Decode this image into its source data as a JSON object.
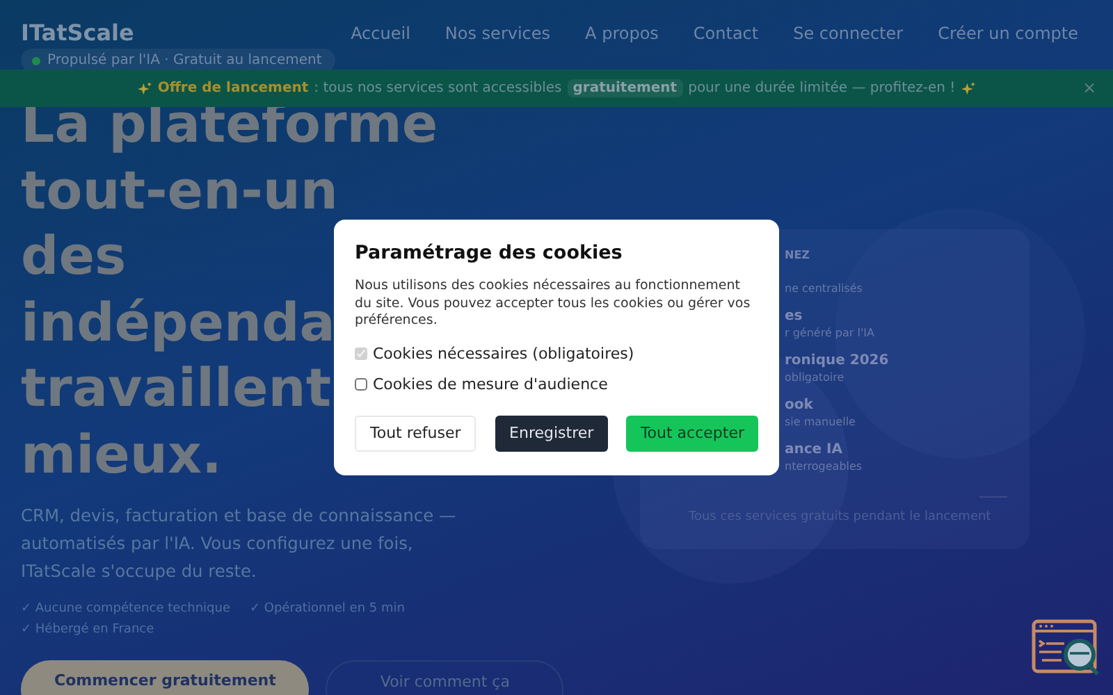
{
  "nav": {
    "logo": "ITatScale",
    "badge": "Propulsé par l'IA · Gratuit au lancement",
    "links": [
      "Accueil",
      "Nos services",
      "A propos",
      "Contact",
      "Se connecter",
      "Créer un compte"
    ]
  },
  "banner": {
    "lead": "Offre de lancement",
    "text_before": ": tous nos services sont accessibles",
    "highlight": "gratuitement",
    "text_after": "pour une durée limitée — profitez-en !",
    "close": "×"
  },
  "hero": {
    "title_lines": [
      "La plateforme",
      "tout-en-un",
      "des",
      "indépenda",
      "travaillent",
      "mieux."
    ],
    "subtitle": "CRM, devis, facturation et base de connaissance — automatisés par l'IA. Vous configurez une fois, ITatScale s'occupe du reste.",
    "checks": [
      "✓ Aucune compétence technique",
      "✓ Opérationnel en 5 min",
      "✓ Hébergé en France"
    ],
    "buttons": [
      {
        "label": "Commencer gratuitement",
        "kind": "primary"
      },
      {
        "label": "Voir comment ça",
        "kind": "outline"
      }
    ]
  },
  "services_card": {
    "heading": "NEZ",
    "items": [
      {
        "description": "ne centralisés"
      },
      {
        "title": "es",
        "description": "r généré par l'IA"
      },
      {
        "title": "ronique 2026",
        "description": "obligatoire"
      },
      {
        "title": "ook",
        "description": "sie manuelle"
      },
      {
        "title": "ance IA",
        "description": "nterrogeables"
      }
    ],
    "footer": "Tous ces services gratuits pendant le lancement"
  },
  "cookie_dialog": {
    "title": "Paramétrage des cookies",
    "text": "Nous utilisons des cookies nécessaires au fonctionnement du site. Vous pouvez accepter tous les cookies ou gérer vos préférences.",
    "options": [
      {
        "label": "Cookies nécessaires (obligatoires)",
        "checked": true,
        "disabled": true
      },
      {
        "label": "Cookies de mesure d'audience",
        "checked": false,
        "disabled": false
      }
    ],
    "buttons": [
      {
        "label": "Tout refuser",
        "kind": "light"
      },
      {
        "label": "Enregistrer",
        "kind": "dark"
      },
      {
        "label": "Tout accepter",
        "kind": "accept"
      }
    ]
  }
}
